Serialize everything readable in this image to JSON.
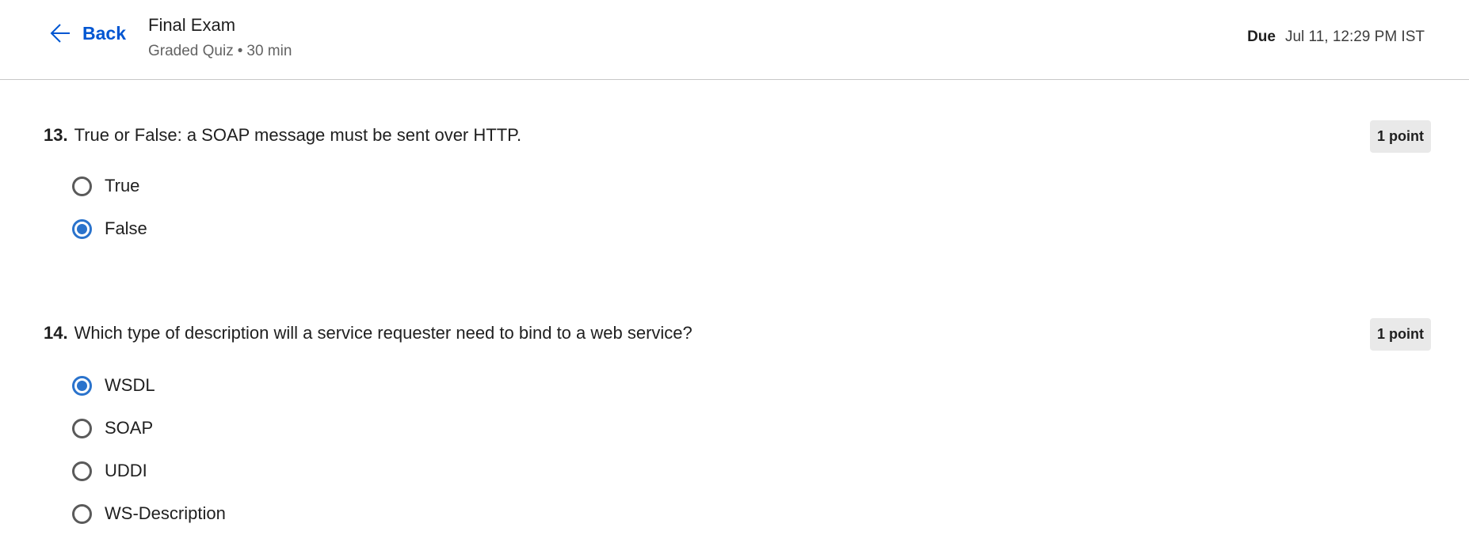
{
  "header": {
    "back_label": "Back",
    "title": "Final Exam",
    "type": "Graded Quiz",
    "separator": "•",
    "duration": "30 min",
    "due_label": "Due",
    "due_value": "Jul 11, 12:29 PM IST"
  },
  "questions": [
    {
      "number": "13.",
      "text": "True or False: a SOAP message must be sent over HTTP.",
      "points": "1 point",
      "options": [
        {
          "label": "True",
          "selected": false
        },
        {
          "label": "False",
          "selected": true
        }
      ]
    },
    {
      "number": "14.",
      "text": "Which type of description will a service requester need to bind to a web service?",
      "points": "1 point",
      "options": [
        {
          "label": "WSDL",
          "selected": true
        },
        {
          "label": "SOAP",
          "selected": false
        },
        {
          "label": "UDDI",
          "selected": false
        },
        {
          "label": "WS-Description",
          "selected": false
        }
      ]
    }
  ],
  "colors": {
    "accent": "#0056d2",
    "radio_selected": "#2a73cc",
    "points_badge_bg": "#e9e9e9"
  },
  "icons": {
    "back": "arrow-left-icon"
  }
}
